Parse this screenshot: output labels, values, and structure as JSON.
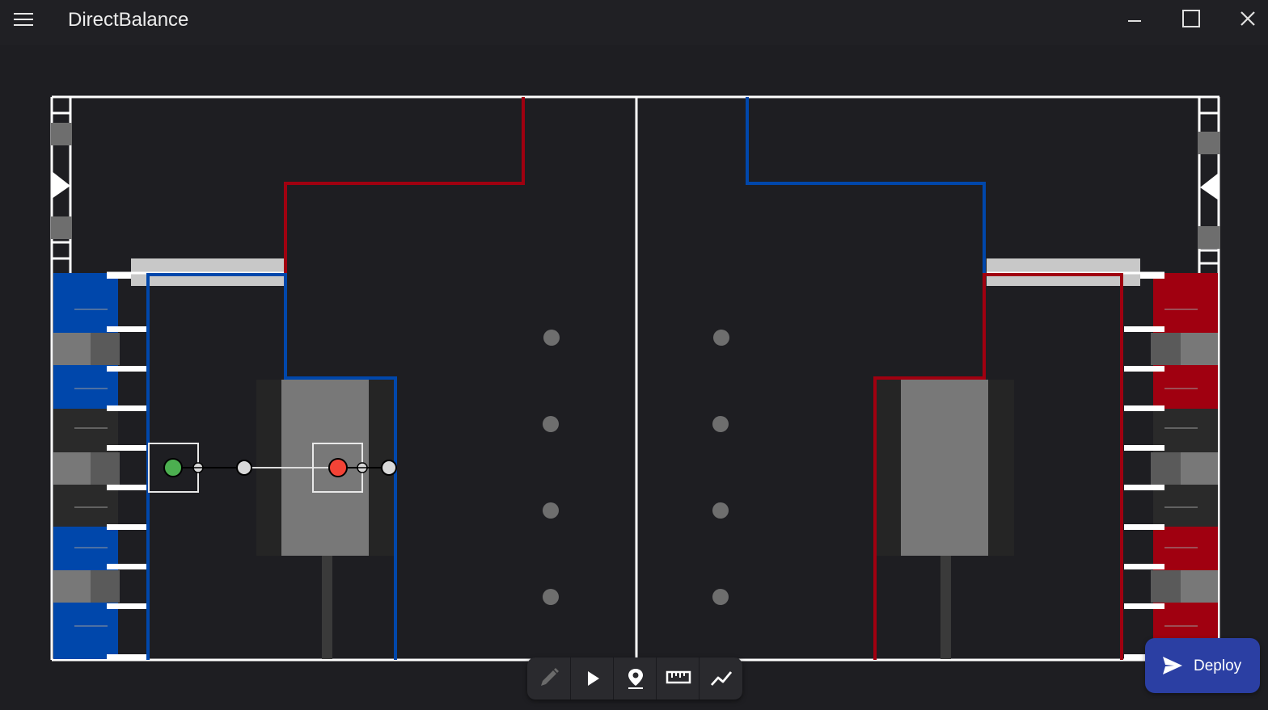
{
  "app": {
    "title": "DirectBalance"
  },
  "window": {
    "minimize_icon": "minimize-icon",
    "maximize_icon": "maximize-icon",
    "close_icon": "close-icon"
  },
  "menu": {
    "icon": "hamburger-menu-icon"
  },
  "field": {
    "colors": {
      "background": "#1e1e22",
      "lines": "#ffffff",
      "blue_alliance": "#0047ab",
      "red_alliance": "#a00010",
      "gray_element": "#787878",
      "dark_element": "#2a2a2a",
      "waypoint_start": "#4caf50",
      "waypoint_end": "#f44336",
      "control_point": "#d9d9d9"
    }
  },
  "toolbar": {
    "tools": [
      {
        "name": "edit-path",
        "icon": "pencil-icon",
        "enabled": false
      },
      {
        "name": "play",
        "icon": "play-icon",
        "enabled": true
      },
      {
        "name": "place-waypoint",
        "icon": "map-pin-icon",
        "enabled": true
      },
      {
        "name": "measure",
        "icon": "ruler-icon",
        "enabled": true
      },
      {
        "name": "graph",
        "icon": "chart-line-icon",
        "enabled": true
      }
    ]
  },
  "deploy": {
    "label": "Deploy",
    "icon": "send-icon",
    "color": "#2b3fa3"
  }
}
